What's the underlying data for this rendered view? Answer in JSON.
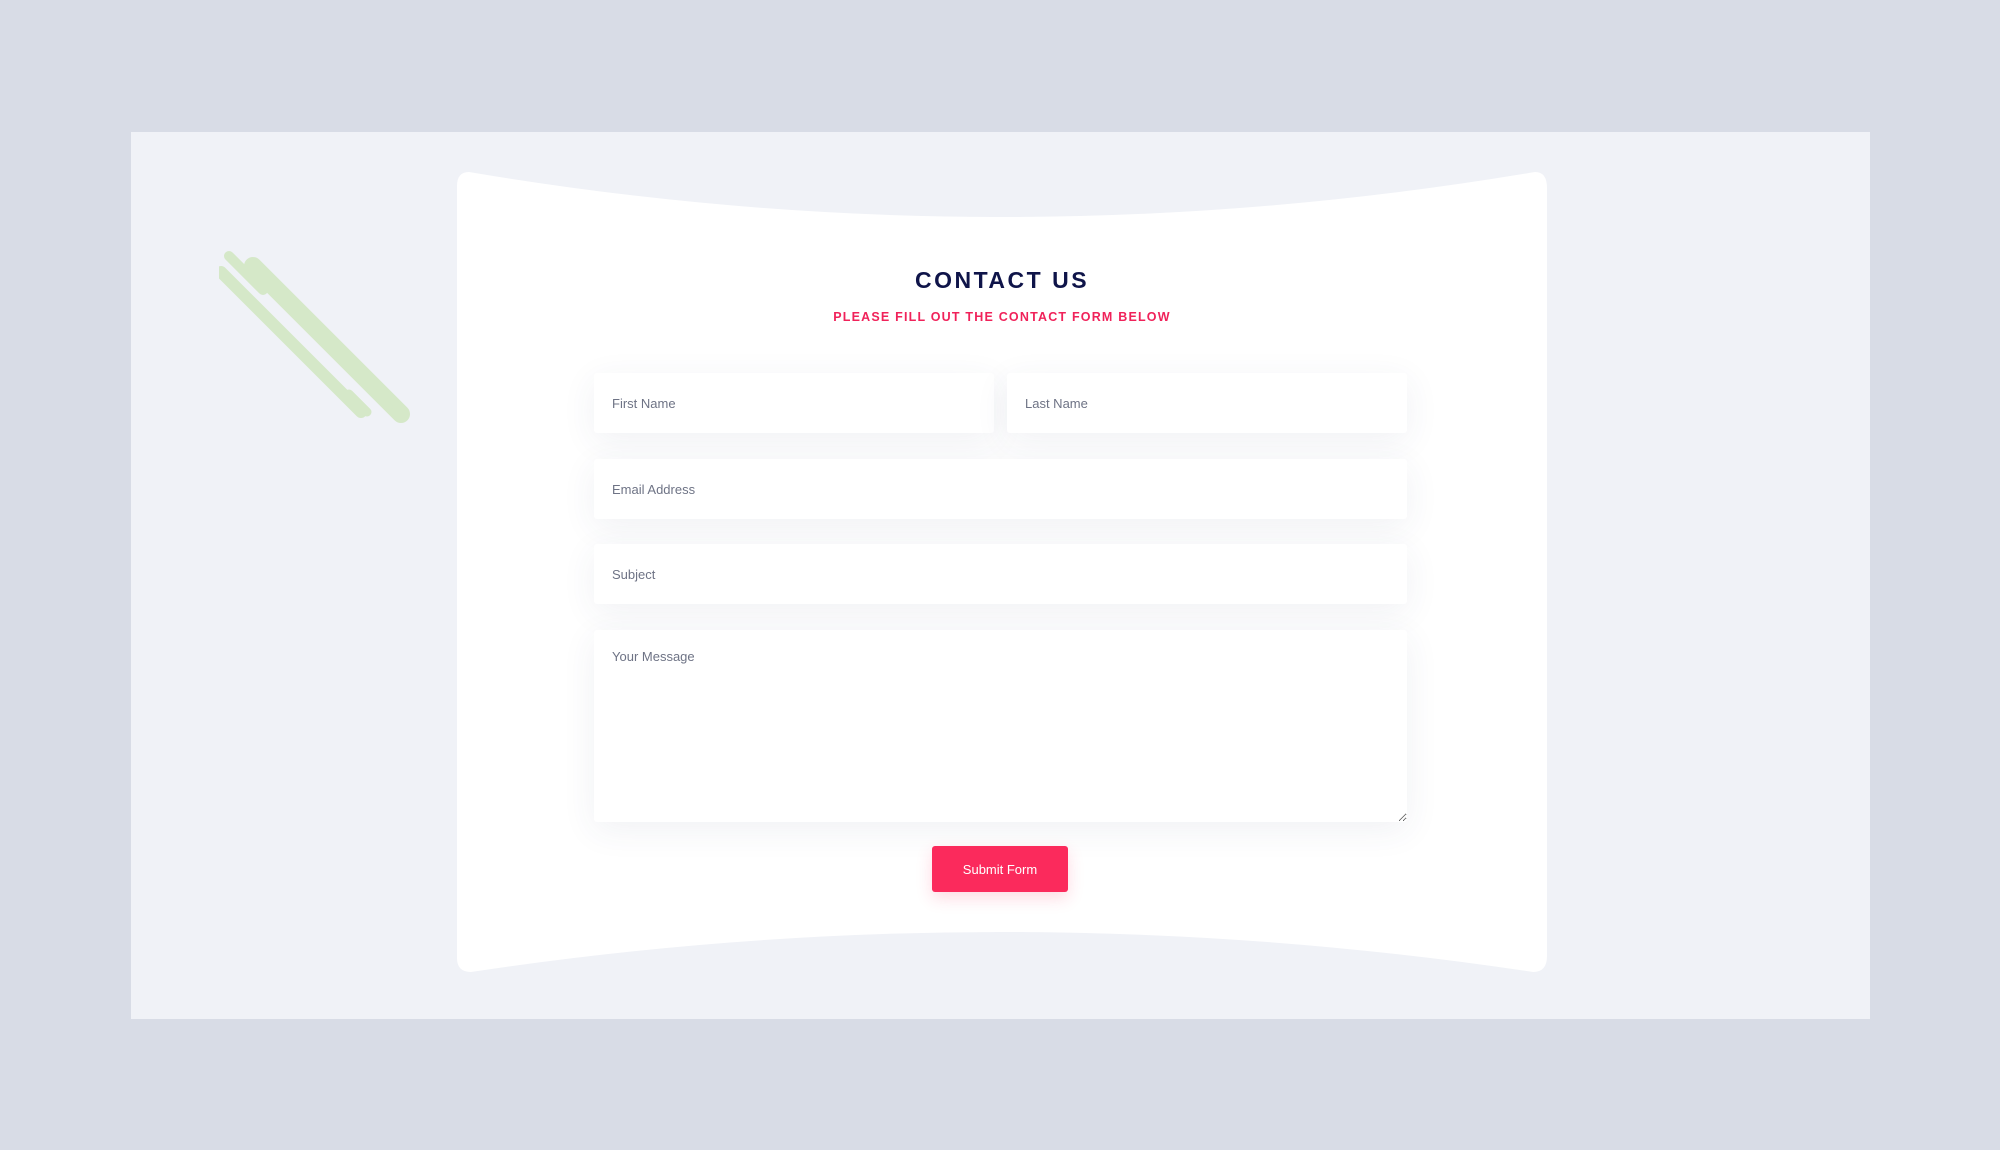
{
  "contact": {
    "title": "CONTACT US",
    "subtitle": "PLEASE FILL OUT THE CONTACT FORM BELOW"
  },
  "form": {
    "first_name": {
      "value": "",
      "placeholder": "First Name"
    },
    "last_name": {
      "value": "",
      "placeholder": "Last Name"
    },
    "email": {
      "value": "",
      "placeholder": "Email Address"
    },
    "subject": {
      "value": "",
      "placeholder": "Subject"
    },
    "message": {
      "value": "",
      "placeholder": "Your Message"
    },
    "submit_label": "Submit Form"
  },
  "colors": {
    "page_background": "#d8dce6",
    "section_background": "#f0f2f7",
    "card": "#ffffff",
    "title": "#0f1449",
    "accent": "#fb2a5c",
    "decoration": "#d5e8c8"
  }
}
